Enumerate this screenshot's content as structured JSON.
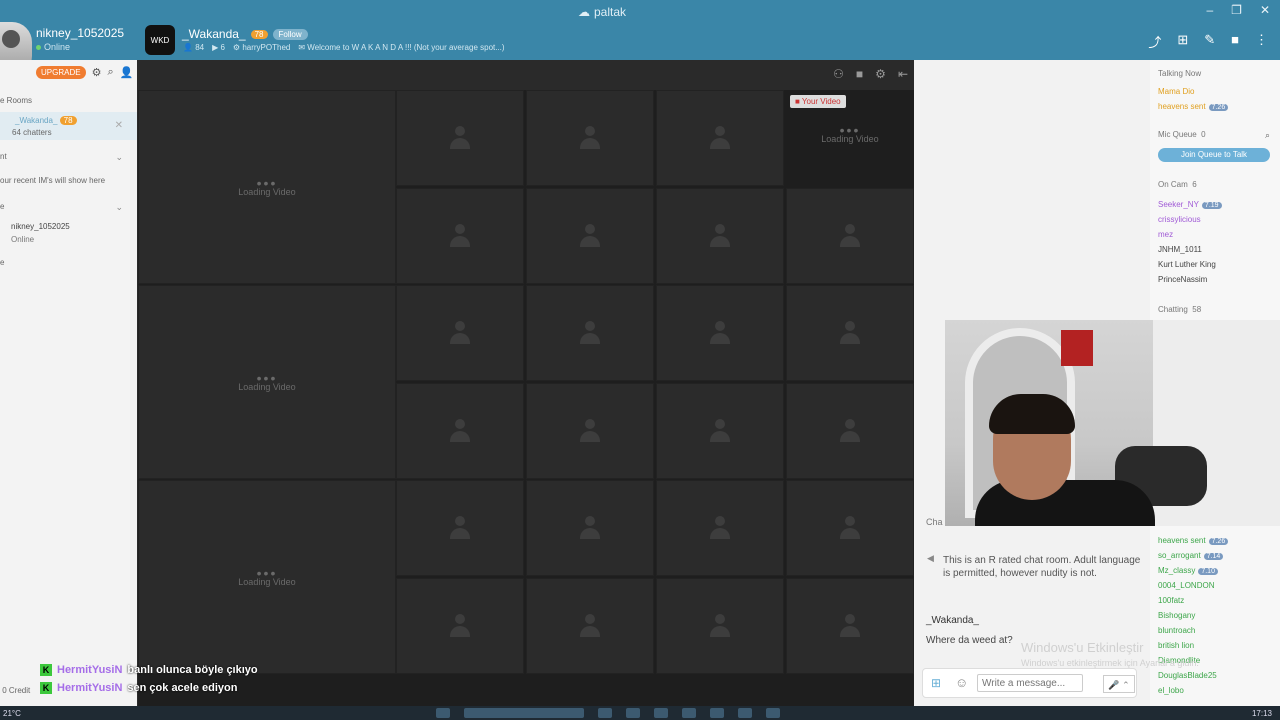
{
  "app": {
    "name": "paltak"
  },
  "user": {
    "name": "nikney_1052025",
    "status": "Online"
  },
  "room": {
    "title": "_Wakanda_",
    "level": "78",
    "follow_label": "Follow",
    "members": "84",
    "cams": "6",
    "host": "harryPOThed",
    "welcome": "Welcome to W A K A N D A !!! (Not your average spot...)"
  },
  "sidebar": {
    "upgrade_label": "UPGRADE",
    "rooms_header": "e Rooms",
    "room_item": {
      "name": "_Wakanda_",
      "level": "78",
      "chatters": "64 chatters"
    },
    "im_header": "nt",
    "im_empty": "our recent IM's will show here",
    "friends_header": "e",
    "friend": {
      "name": "nikney_1052025",
      "status": "Online"
    },
    "misc": "e",
    "credits": "0 Credit"
  },
  "video": {
    "loading_label": "Loading Video",
    "your_video_label": "Your Video"
  },
  "userlist": {
    "talking_now_label": "Talking Now",
    "talking": [
      {
        "name": "Mama Dio",
        "color": "#e0a020"
      },
      {
        "name": "heavens sent",
        "color": "#e0a020",
        "badge": "7.26"
      }
    ],
    "mic_queue_label": "Mic Queue",
    "mic_queue_count": "0",
    "join_queue_label": "Join Queue to Talk",
    "on_cam_label": "On Cam",
    "on_cam_count": "6",
    "on_cam": [
      {
        "name": "Seeker_NY",
        "color": "#a05ad6",
        "badge": "7.19"
      },
      {
        "name": "crissylicious",
        "color": "#a05ad6"
      },
      {
        "name": "mez",
        "color": "#a05ad6"
      },
      {
        "name": "JNHM_1011",
        "color": "#444444"
      },
      {
        "name": "Kurt Luther King",
        "color": "#444444"
      },
      {
        "name": "PrinceNassim",
        "color": "#444444"
      }
    ],
    "chatting_label": "Chatting",
    "chatting_count": "58",
    "chatting": [
      {
        "name": "heavens sent",
        "color": "#3da64a",
        "badge": "7.26"
      },
      {
        "name": "so_arrogant",
        "color": "#3da64a",
        "badge": "7.14"
      },
      {
        "name": "Mz_classy",
        "color": "#3da64a",
        "badge": "7.10"
      },
      {
        "name": "0004_LONDON",
        "color": "#3da64a"
      },
      {
        "name": "100fatz",
        "color": "#3da64a"
      },
      {
        "name": "Bishogany",
        "color": "#3da64a"
      },
      {
        "name": "bluntroach",
        "color": "#3da64a"
      },
      {
        "name": "british lion",
        "color": "#3da64a"
      },
      {
        "name": "Diamondlite",
        "color": "#3da64a"
      },
      {
        "name": "DouglasBlade25",
        "color": "#3da64a"
      },
      {
        "name": "el_lobo",
        "color": "#3da64a"
      }
    ]
  },
  "chat": {
    "label": "Cha",
    "notice": "This is an R rated chat room. Adult language is permitted, however nudity is not.",
    "messages": [
      {
        "author": "_Wakanda_",
        "text": "Where da weed at?"
      }
    ],
    "composer_placeholder": "Write a message...",
    "watermark_title": "Windows'u Etkinleştir",
    "watermark_sub": "Windows'u etkinleştirmek için Ayarlar'a gidin."
  },
  "stream_overlay": [
    {
      "nick": "HermitYusiN",
      "text": "banlı olunca böyle çıkıyo"
    },
    {
      "nick": "HermitYusiN",
      "text": "sen çok acele ediyon"
    }
  ],
  "taskbar": {
    "temp": "21°C",
    "time": "17:13"
  }
}
